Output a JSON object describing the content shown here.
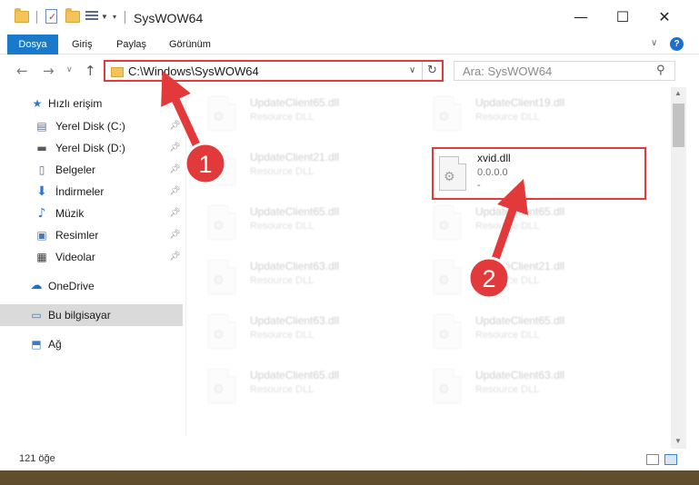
{
  "window": {
    "title": "SysWOW64",
    "controls": {
      "minimize": "—",
      "maximize": "☐",
      "close": "✕"
    }
  },
  "ribbon": {
    "tabs": [
      "Dosya",
      "Giriş",
      "Paylaş",
      "Görünüm"
    ],
    "help": "?"
  },
  "nav": {
    "back": "←",
    "forward": "→",
    "dropdown": "∨",
    "up": "↑",
    "address": "C:\\Windows\\SysWOW64",
    "refresh": "↻",
    "search_placeholder": "Ara: SysWOW64",
    "search_icon": "⚲"
  },
  "sidebar": {
    "quick_access": "Hızlı erişim",
    "items": [
      {
        "label": "Yerel Disk (C:)",
        "icon": "drive-icon",
        "pinned": true
      },
      {
        "label": "Yerel Disk (D:)",
        "icon": "drive-icon",
        "pinned": true
      },
      {
        "label": "Belgeler",
        "icon": "documents-icon",
        "pinned": true
      },
      {
        "label": "İndirmeler",
        "icon": "download-icon",
        "pinned": true
      },
      {
        "label": "Müzik",
        "icon": "music-icon",
        "pinned": true
      },
      {
        "label": "Resimler",
        "icon": "pictures-icon",
        "pinned": true
      },
      {
        "label": "Videolar",
        "icon": "videos-icon",
        "pinned": true
      }
    ],
    "onedrive": "OneDrive",
    "this_pc": "Bu bilgisayar",
    "network": "Ağ"
  },
  "files": {
    "left": [
      {
        "name": "UpdateClient65.dll",
        "desc": "Resource DLL"
      },
      {
        "name": "UpdateClient21.dll",
        "desc": "Resource DLL"
      },
      {
        "name": "UpdateClient65.dll",
        "desc": "Resource DLL"
      },
      {
        "name": "UpdateClient63.dll",
        "desc": "Resource DLL"
      },
      {
        "name": "UpdateClient63.dll",
        "desc": "Resource DLL"
      },
      {
        "name": "UpdateClient65.dll",
        "desc": "Resource DLL"
      }
    ],
    "right": [
      {
        "name": "UpdateClient19.dll",
        "desc": "Resource DLL"
      },
      {
        "name": "xvid.dll",
        "desc": "0.0.0.0",
        "ver": "-",
        "highlight": true
      },
      {
        "name": "UpdateClient65.dll",
        "desc": "Resource DLL"
      },
      {
        "name": "UpdateClient21.dll",
        "desc": "Resource DLL"
      },
      {
        "name": "UpdateClient65.dll",
        "desc": "Resource DLL"
      },
      {
        "name": "UpdateClient63.dll",
        "desc": "Resource DLL"
      }
    ]
  },
  "status": {
    "count": "121 öğe"
  },
  "annotations": {
    "step1": "1",
    "step2": "2",
    "color": "#e23a3a"
  }
}
